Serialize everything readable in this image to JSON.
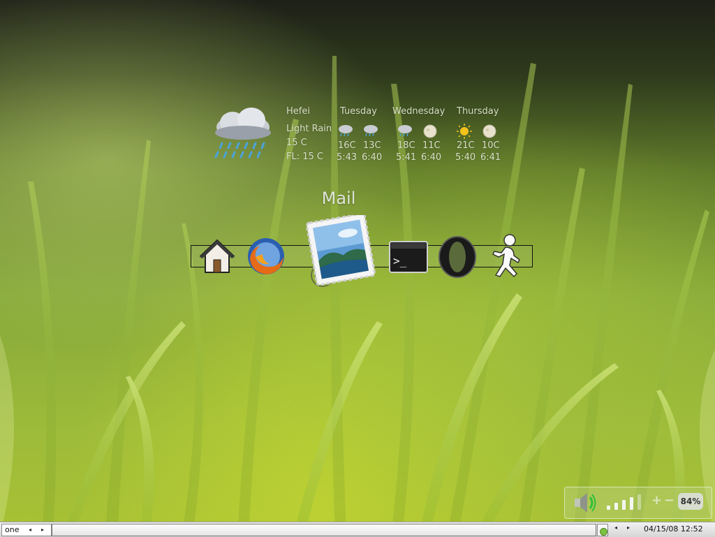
{
  "desktop": {
    "weather": {
      "city": "Hefei",
      "condition": "Light Rain",
      "temp": "15 C",
      "feels_like": "FL: 15 C",
      "main_icon": "heavy-rain-cloud-icon",
      "days": [
        {
          "name": "Tuesday",
          "icons": [
            "rain-cloud-icon",
            "rain-cloud-icon"
          ],
          "high": "16C",
          "low": "13C",
          "sunrise": "5:43",
          "sunset": "6:40"
        },
        {
          "name": "Wednesday",
          "icons": [
            "rain-cloud-icon",
            "moon-icon"
          ],
          "high": "18C",
          "low": "11C",
          "sunrise": "5:41",
          "sunset": "6:40"
        },
        {
          "name": "Thursday",
          "icons": [
            "sun-icon",
            "moon-icon"
          ],
          "high": "21C",
          "low": "10C",
          "sunrise": "5:40",
          "sunset": "6:41"
        }
      ]
    },
    "dock": {
      "hover_label": "Mail",
      "items": [
        {
          "name": "Home",
          "icon": "home-icon"
        },
        {
          "name": "Firefox",
          "icon": "firefox-icon"
        },
        {
          "name": "Mail",
          "icon": "mail-stamp-icon"
        },
        {
          "name": "Terminal",
          "icon": "terminal-icon",
          "glyph": ">_"
        },
        {
          "name": "Opera",
          "icon": "opera-icon",
          "glyph": "O"
        },
        {
          "name": "AIM",
          "icon": "aim-running-man-icon"
        }
      ]
    },
    "tray": {
      "volume_icon": "speaker-icon",
      "signal_level": 4,
      "signal_max": 5,
      "plus": "+",
      "minus": "−",
      "battery": "84%"
    }
  },
  "taskbar": {
    "workspace": "one",
    "prev": "◂",
    "next": "▸",
    "clock": "04/15/08 12:52",
    "colors": {
      "bar": "#d6d6d6",
      "indicator": "#7cc243"
    }
  }
}
